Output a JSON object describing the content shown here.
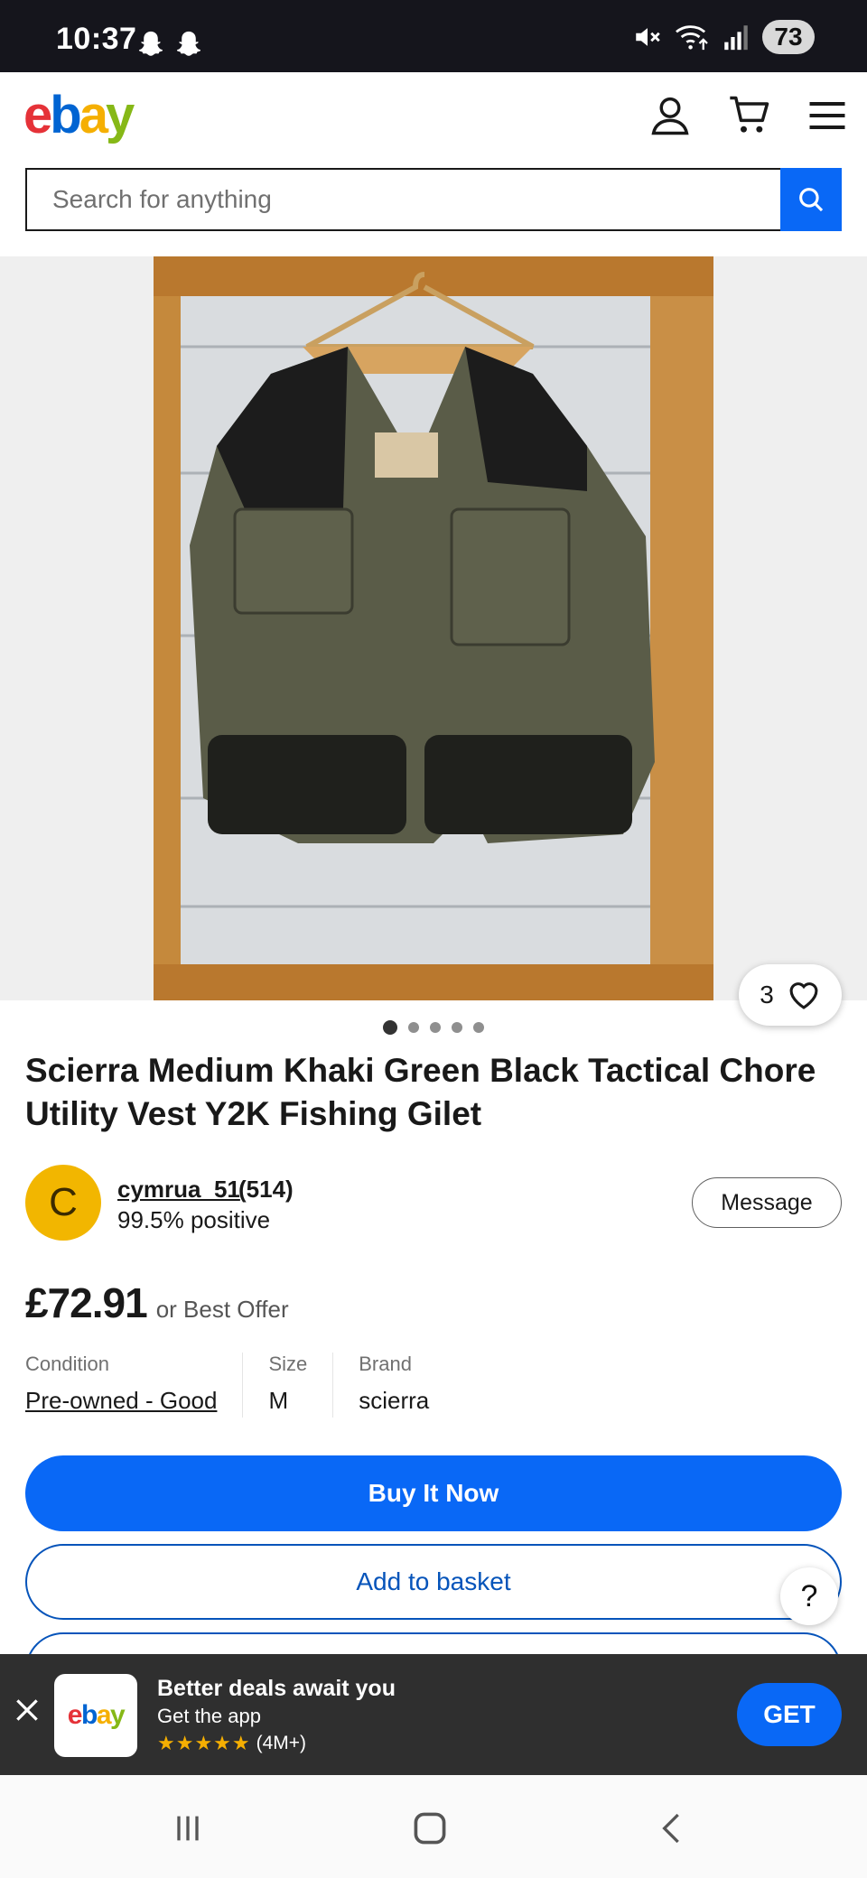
{
  "status_bar": {
    "time": "10:37",
    "battery": "73",
    "icons": [
      "snapchat-ghost-icon",
      "snapchat-ghost-icon",
      "mute-icon",
      "wifi-icon",
      "signal-icon"
    ]
  },
  "header": {
    "logo": {
      "e": "e",
      "b": "b",
      "a": "a",
      "y": "y"
    },
    "icons": [
      "account-icon",
      "cart-icon",
      "menu-icon"
    ]
  },
  "search": {
    "placeholder": "Search for anything"
  },
  "gallery": {
    "watchers_count": "3",
    "dot_count": 5,
    "active_dot": 0
  },
  "listing": {
    "title": "Scierra Medium Khaki Green Black Tactical Chore Utility Vest Y2K Fishing Gilet",
    "seller": {
      "initial": "C",
      "name": "cymrua_51",
      "feedback_count": "(514)",
      "rating": "99.5% positive",
      "message_label": "Message"
    },
    "price": "£72.91",
    "price_suffix": "or Best Offer",
    "specs": {
      "condition_label": "Condition",
      "condition_value": "Pre-owned - Good",
      "size_label": "Size",
      "size_value": "M",
      "brand_label": "Brand",
      "brand_value": "scierra"
    },
    "buy_now_label": "Buy It Now",
    "add_to_basket_label": "Add to basket",
    "help_label": "?"
  },
  "app_banner": {
    "title": "Better deals await you",
    "subtitle": "Get the app",
    "stars": "★★★★★",
    "rating_count": "(4M+)",
    "get_label": "GET",
    "icon_letters": {
      "e": "e",
      "b": "b",
      "a": "a",
      "y": "y"
    }
  },
  "colors": {
    "ebay_red": "#e53238",
    "ebay_blue": "#0064d2",
    "ebay_yellow": "#f5af02",
    "ebay_green": "#86b817",
    "cta_blue": "#0968f6",
    "avatar_yellow": "#f2b600"
  }
}
